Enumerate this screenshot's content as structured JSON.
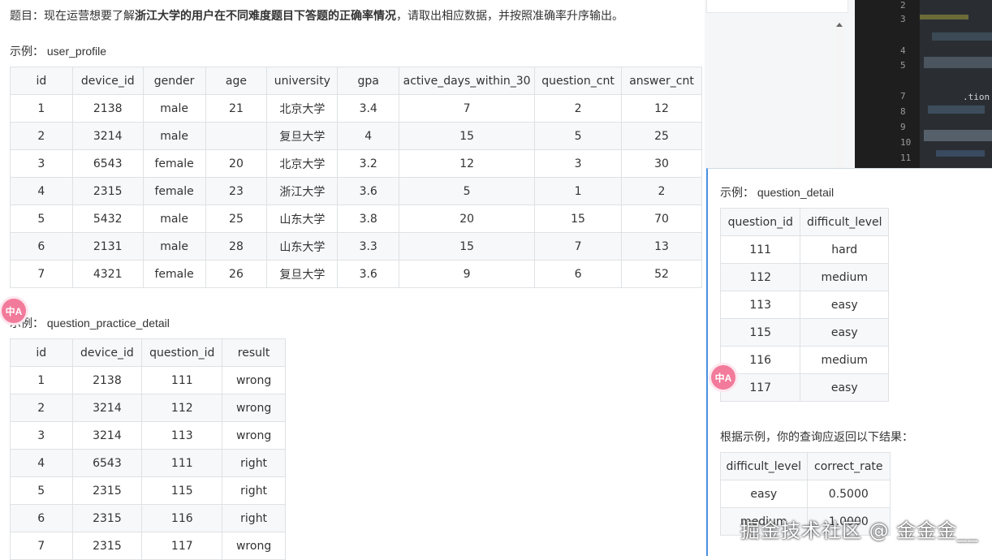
{
  "question": {
    "prefix": "题目：现在运营想要了解",
    "bold": "浙江大学的用户在不同难度题目下答题的正确率情况",
    "suffix": "，请取出相应数据，并按照准确率升序输出。"
  },
  "user_profile": {
    "label": "示例：  user_profile",
    "columns": [
      "id",
      "device_id",
      "gender",
      "age",
      "university",
      "gpa",
      "active_days_within_30",
      "question_cnt",
      "answer_cnt"
    ],
    "rows": [
      [
        "1",
        "2138",
        "male",
        "21",
        "北京大学",
        "3.4",
        "7",
        "2",
        "12"
      ],
      [
        "2",
        "3214",
        "male",
        "",
        "复旦大学",
        "4",
        "15",
        "5",
        "25"
      ],
      [
        "3",
        "6543",
        "female",
        "20",
        "北京大学",
        "3.2",
        "12",
        "3",
        "30"
      ],
      [
        "4",
        "2315",
        "female",
        "23",
        "浙江大学",
        "3.6",
        "5",
        "1",
        "2"
      ],
      [
        "5",
        "5432",
        "male",
        "25",
        "山东大学",
        "3.8",
        "20",
        "15",
        "70"
      ],
      [
        "6",
        "2131",
        "male",
        "28",
        "山东大学",
        "3.3",
        "15",
        "7",
        "13"
      ],
      [
        "7",
        "4321",
        "female",
        "26",
        "复旦大学",
        "3.6",
        "9",
        "6",
        "52"
      ]
    ]
  },
  "question_practice_detail": {
    "label": "示例：  question_practice_detail",
    "columns": [
      "id",
      "device_id",
      "question_id",
      "result"
    ],
    "rows": [
      [
        "1",
        "2138",
        "111",
        "wrong"
      ],
      [
        "2",
        "3214",
        "112",
        "wrong"
      ],
      [
        "3",
        "3214",
        "113",
        "wrong"
      ],
      [
        "4",
        "6543",
        "111",
        "right"
      ],
      [
        "5",
        "2315",
        "115",
        "right"
      ],
      [
        "6",
        "2315",
        "116",
        "right"
      ],
      [
        "7",
        "2315",
        "117",
        "wrong"
      ]
    ]
  },
  "question_detail": {
    "label": "示例：  question_detail",
    "columns": [
      "question_id",
      "difficult_level"
    ],
    "rows": [
      [
        "111",
        "hard"
      ],
      [
        "112",
        "medium"
      ],
      [
        "113",
        "easy"
      ],
      [
        "115",
        "easy"
      ],
      [
        "116",
        "medium"
      ],
      [
        "117",
        "easy"
      ]
    ]
  },
  "result": {
    "label": "根据示例，你的查询应返回以下结果：",
    "columns": [
      "difficult_level",
      "correct_rate"
    ],
    "rows": [
      [
        "easy",
        "0.5000"
      ],
      [
        "medium",
        "1.0000"
      ]
    ]
  },
  "editor": {
    "line_numbers": [
      "2",
      "3",
      "4",
      "5",
      "7",
      "8",
      "9",
      "10",
      "11"
    ],
    "snippet": ".tion"
  },
  "float_icon_text": "中A",
  "watermark": "掘金技术社区 @ 金金金__",
  "colors": {
    "accent": "#4a90e2",
    "icon": "#f27a9a",
    "stripe": "#f6f8fa",
    "border": "#dfe2e5"
  }
}
